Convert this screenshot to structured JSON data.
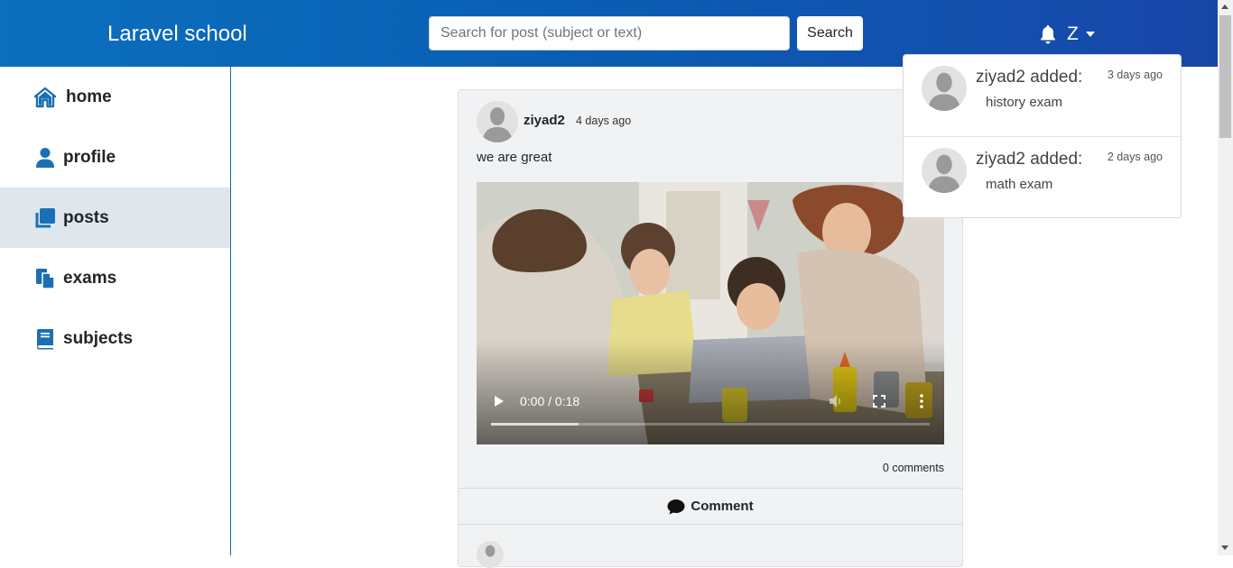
{
  "navbar": {
    "brand": "Laravel school",
    "search_placeholder": "Search for post (subject or text)",
    "search_button": "Search",
    "user_initial": "Z"
  },
  "sidebar": {
    "items": [
      {
        "label": "home",
        "icon": "home-icon"
      },
      {
        "label": "profile",
        "icon": "user-icon"
      },
      {
        "label": "posts",
        "icon": "posts-icon",
        "active": true
      },
      {
        "label": "exams",
        "icon": "exams-icon"
      },
      {
        "label": "subjects",
        "icon": "book-icon"
      }
    ]
  },
  "post": {
    "author": "ziyad2",
    "time": "4 days ago",
    "text": "we are great",
    "video": {
      "time_display": "0:00 / 0:18",
      "buffered_fraction": 0.2
    },
    "comments_count": "0 comments",
    "comment_button": "Comment"
  },
  "notifications": [
    {
      "who": "ziyad2 added:",
      "time": "3 days ago",
      "what": "history exam"
    },
    {
      "who": "ziyad2 added:",
      "time": "2 days ago",
      "what": "math exam"
    }
  ],
  "colors": {
    "primary": "#0b6fbd",
    "nav_end": "#1846a8",
    "active_bg": "#dfe6ec",
    "card_bg": "#f1f2f4"
  }
}
